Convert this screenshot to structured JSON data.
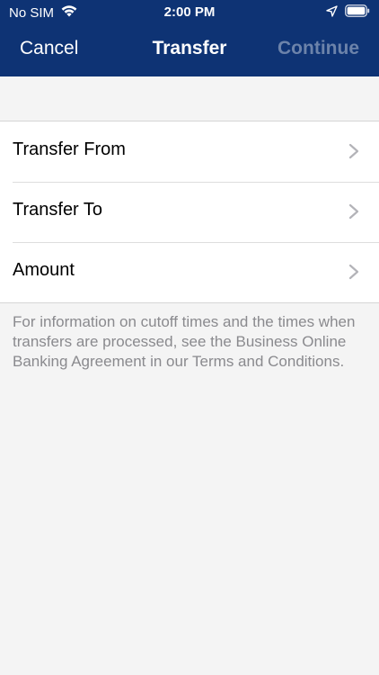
{
  "status_bar": {
    "carrier": "No SIM",
    "time": "2:00 PM"
  },
  "nav": {
    "cancel_label": "Cancel",
    "title": "Transfer",
    "continue_label": "Continue"
  },
  "rows": [
    {
      "label": "Transfer From"
    },
    {
      "label": "Transfer To"
    },
    {
      "label": "Amount"
    }
  ],
  "footnote": "For information on cutoff times and the times when transfers are processed, see the Business Online Banking Agreement in our Terms and Conditions.",
  "colors": {
    "header_bg": "#0e3374",
    "continue_disabled": "#6c83aa",
    "background": "#f4f4f4"
  },
  "icons": [
    "wifi-icon",
    "location-arrow-icon",
    "battery-icon",
    "chevron-right-icon"
  ]
}
